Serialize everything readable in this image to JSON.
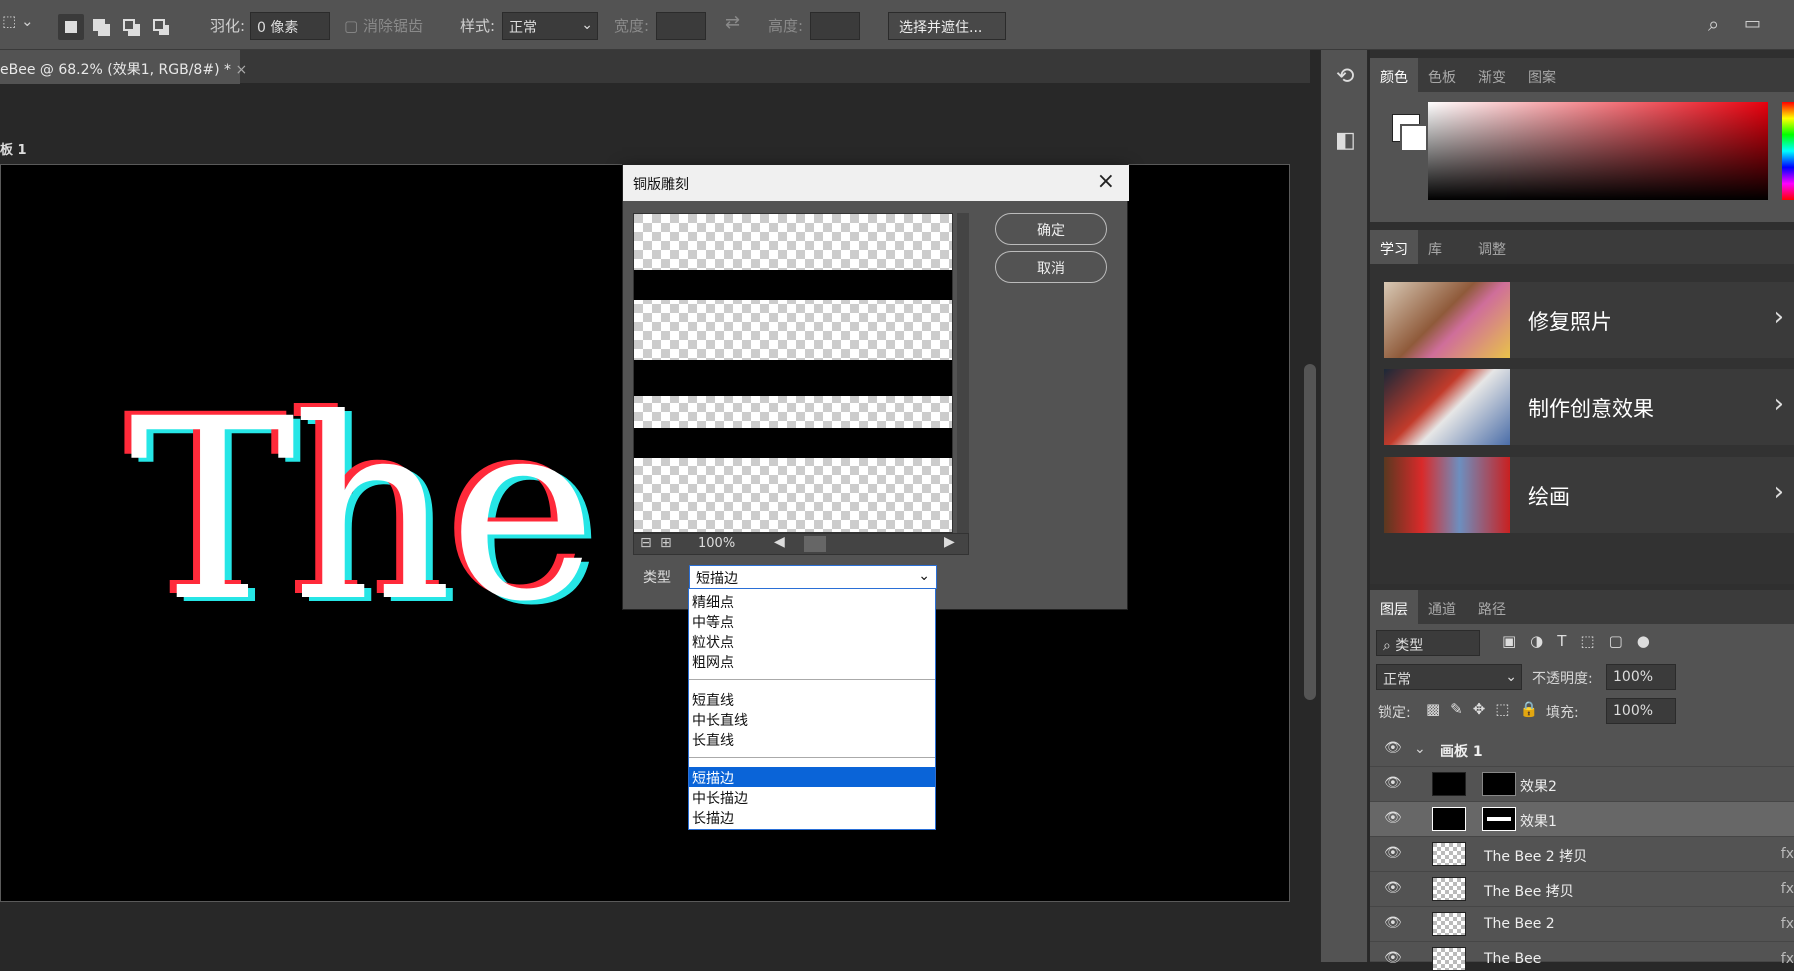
{
  "options_bar": {
    "feather_label": "羽化:",
    "feather_value": "0 像素",
    "anti_alias": "消除锯齿",
    "style_label": "样式:",
    "style_value": "正常",
    "width_label": "宽度:",
    "height_label": "高度:",
    "select_mask_btn": "选择并遮住..."
  },
  "document": {
    "tab_title": "eBee @ 68.2% (效果1, RGB/8#) *",
    "artboard_label": "板 1",
    "canvas_text": "The"
  },
  "dialog": {
    "title": "铜版雕刻",
    "ok": "确定",
    "cancel": "取消",
    "zoom": "100%",
    "type_label": "类型",
    "type_value": "短描边",
    "options": [
      "精细点",
      "中等点",
      "粒状点",
      "粗网点",
      "短直线",
      "中长直线",
      "长直线",
      "短描边",
      "中长描边",
      "长描边"
    ],
    "selected_index": 7
  },
  "color_panel": {
    "tabs": [
      "颜色",
      "色板",
      "渐变",
      "图案"
    ],
    "fg": "#ffffff",
    "bg": "#ffffff"
  },
  "learn_panel": {
    "tabs": [
      "学习",
      "库",
      "调整"
    ],
    "cards": [
      "修复照片",
      "制作创意效果",
      "绘画"
    ]
  },
  "layers_panel": {
    "tabs": [
      "图层",
      "通道",
      "路径"
    ],
    "filter_kind": "类型",
    "blend_mode": "正常",
    "opacity_label": "不透明度:",
    "opacity": "100%",
    "lock_label": "锁定:",
    "fill_label": "填充:",
    "fill": "100%",
    "group": "画板 1",
    "layers": [
      "效果2",
      "效果1",
      "The Bee 2 拷贝",
      "The Bee 拷贝",
      "The Bee 2",
      "The Bee"
    ],
    "fx": "fx"
  }
}
